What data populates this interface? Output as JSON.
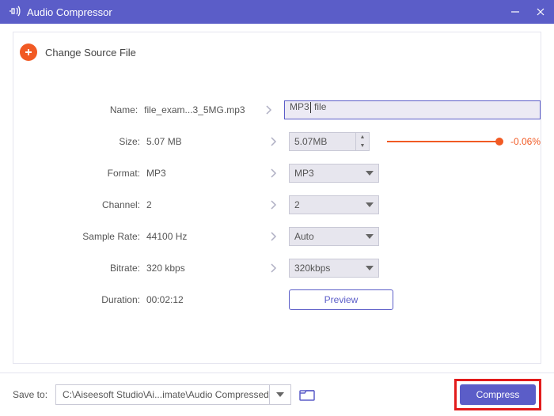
{
  "titlebar": {
    "title": "Audio Compressor"
  },
  "changeSource": {
    "label": "Change Source File"
  },
  "rows": {
    "name": {
      "label": "Name:",
      "value": "file_exam...3_5MG.mp3",
      "input_before": "MP3",
      "input_after": " file"
    },
    "size": {
      "label": "Size:",
      "value": "5.07 MB",
      "control": "5.07MB",
      "delta": "-0.06%"
    },
    "format": {
      "label": "Format:",
      "value": "MP3",
      "control": "MP3"
    },
    "channel": {
      "label": "Channel:",
      "value": "2",
      "control": "2"
    },
    "sampleRate": {
      "label": "Sample Rate:",
      "value": "44100 Hz",
      "control": "Auto"
    },
    "bitrate": {
      "label": "Bitrate:",
      "value": "320 kbps",
      "control": "320kbps"
    },
    "duration": {
      "label": "Duration:",
      "value": "00:02:12"
    },
    "preview": {
      "label": "Preview"
    }
  },
  "bottom": {
    "saveLabel": "Save to:",
    "path": "C:\\Aiseesoft Studio\\Ai...imate\\Audio Compressed",
    "compress": "Compress"
  }
}
